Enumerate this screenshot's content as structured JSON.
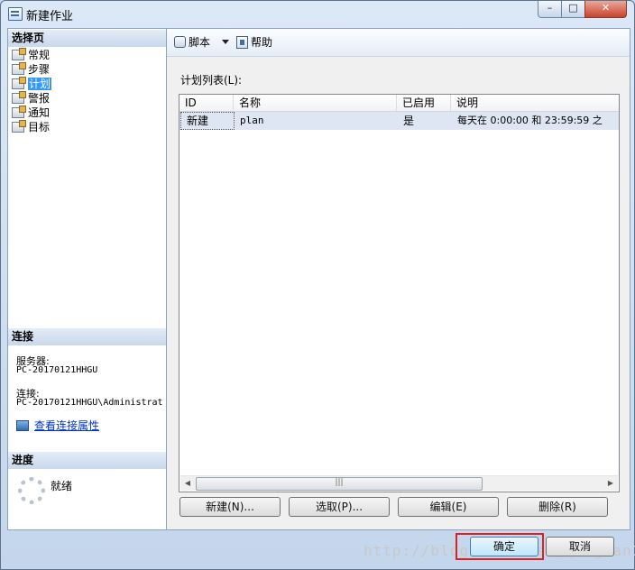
{
  "window": {
    "title": "新建作业",
    "minimize_glyph": "–",
    "maximize_glyph": "□",
    "close_glyph": "✕"
  },
  "left_pane": {
    "select_page_header": "选择页",
    "pages": [
      {
        "label": "常规",
        "selected": false
      },
      {
        "label": "步骤",
        "selected": false
      },
      {
        "label": "计划",
        "selected": true
      },
      {
        "label": "警报",
        "selected": false
      },
      {
        "label": "通知",
        "selected": false
      },
      {
        "label": "目标",
        "selected": false
      }
    ],
    "connection_header": "连接",
    "server_label": "服务器:",
    "server_value": "PC-20170121HHGU",
    "connection_label": "连接:",
    "connection_value": "PC-20170121HHGU\\Administrat",
    "view_connection_link": "查看连接属性",
    "progress_header": "进度",
    "progress_status": "就绪"
  },
  "toolbar": {
    "script_label": "脚本",
    "help_label": "帮助"
  },
  "schedule_list": {
    "label": "计划列表(L):",
    "columns": [
      "ID",
      "名称",
      "已启用",
      "说明"
    ],
    "rows": [
      {
        "id": "新建",
        "name": "plan",
        "enabled": "是",
        "description": "每天在 0:00:00 和 23:59:59 之"
      }
    ],
    "scroll_thumb_glyph": "|||"
  },
  "list_buttons": {
    "new": "新建(N)...",
    "pick": "选取(P)...",
    "edit": "编辑(E)",
    "delete": "删除(R)"
  },
  "dialog_buttons": {
    "ok": "确定",
    "cancel": "取消"
  },
  "watermark": "http://blog.csdn.net/qingdan1"
}
